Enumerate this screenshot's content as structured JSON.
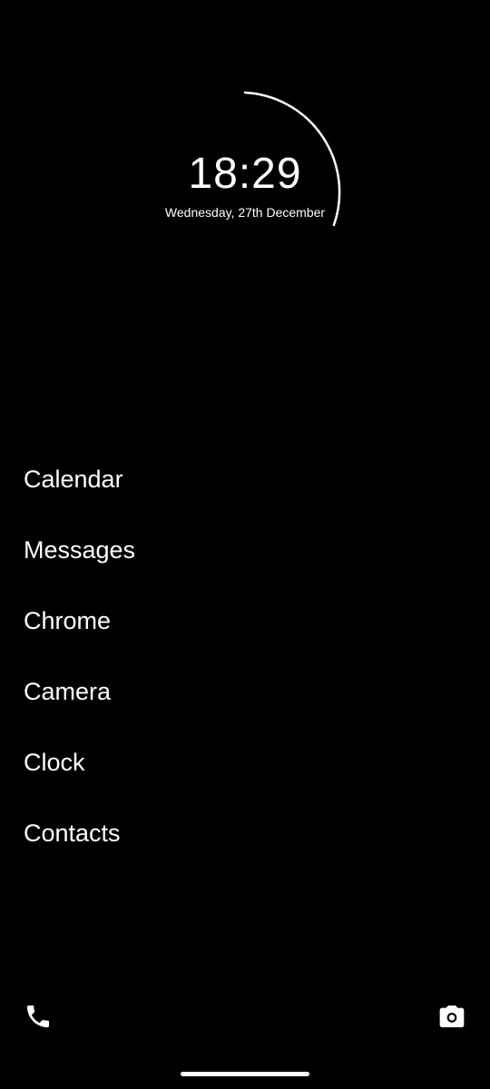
{
  "clock": {
    "time": "18:29",
    "date": "Wednesday, 27th December"
  },
  "apps": [
    {
      "label": "Calendar"
    },
    {
      "label": "Messages"
    },
    {
      "label": "Chrome"
    },
    {
      "label": "Camera"
    },
    {
      "label": "Clock"
    },
    {
      "label": "Contacts"
    }
  ],
  "dock": {
    "left_icon": "phone-icon",
    "right_icon": "camera-icon"
  },
  "colors": {
    "background": "#000000",
    "foreground": "#ffffff"
  }
}
